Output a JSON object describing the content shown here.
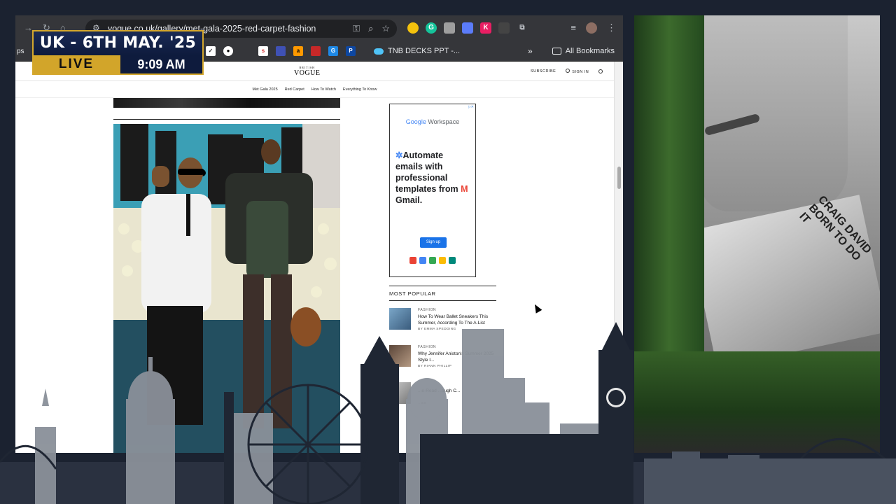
{
  "browser": {
    "url": "vogue.co.uk/gallery/met-gala-2025-red-carpet-fashion",
    "bookmarks": {
      "left_fragment": "ps",
      "tnb_label": "TNB DECKS PPT -...",
      "all_bookmarks": "All Bookmarks"
    }
  },
  "ticker": {
    "date": "UK - 6TH MAY. '25",
    "live": "LIVE",
    "time": "9:09 AM"
  },
  "vogue": {
    "logo_small": "BRITISH",
    "logo_big": "VOGUE",
    "subscribe": "SUBSCRIBE",
    "sign_in": "SIGN IN",
    "subnav": [
      "Met Gala 2025",
      "Red Carpet",
      "How To Watch",
      "Everything To Know"
    ]
  },
  "ad": {
    "brand_google": "Google",
    "brand_workspace": "Workspace",
    "copy_1": "Automate emails with professional templates from",
    "copy_2": "Gmail.",
    "signup": "Sign up"
  },
  "most_popular": {
    "heading": "MOST POPULAR",
    "items": [
      {
        "category": "FASHION",
        "title": "How To Wear Ballet Sneakers This Summer, According To The A-List",
        "byline": "BY EMMA SPEDDING"
      },
      {
        "category": "FASHION",
        "title": "Why Jennifer Aniston's Summer 2025 Style I...",
        "byline": "BY RIANN PHILLIP"
      },
      {
        "category": "",
        "title": "...e-Read ...ough C...",
        "byline": "...ES"
      }
    ]
  },
  "video": {
    "record_text_1": "CRAIG DAVID",
    "record_text_2": "BORN TO DO IT"
  },
  "colors": {
    "ticker_gold": "#d2a52a",
    "ticker_navy": "#0e1b3d",
    "chrome_dark": "#35363a",
    "skyline": "#8a9099"
  }
}
